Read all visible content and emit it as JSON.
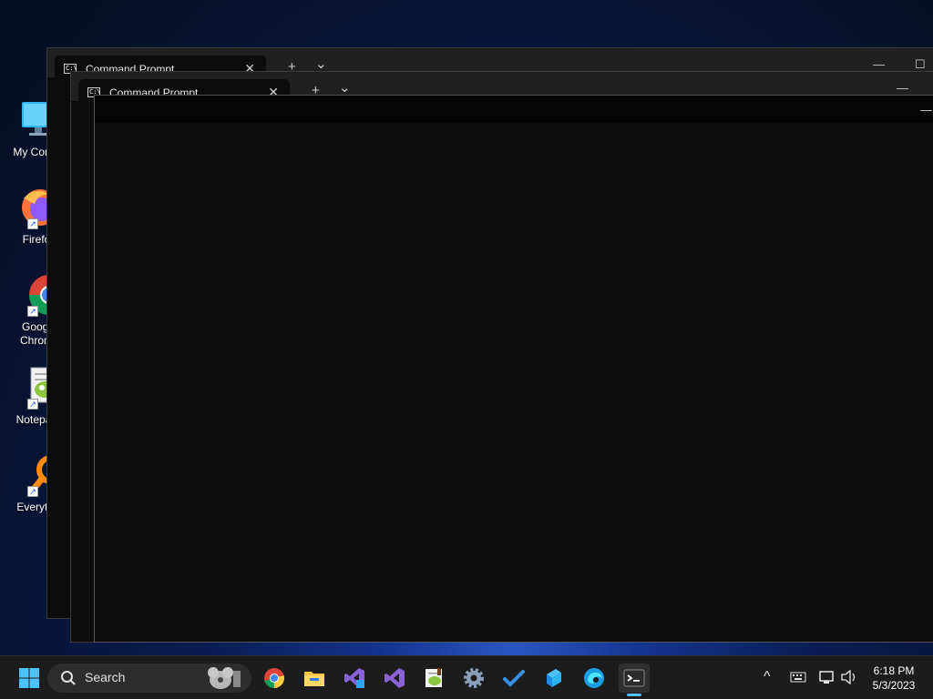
{
  "desktop": {
    "icons": [
      {
        "label": "My Comp",
        "icon": "computer-icon"
      },
      {
        "label": "Firefo",
        "icon": "firefox-icon"
      },
      {
        "label": "Googl",
        "label2": "Chrom",
        "icon": "chrome-icon"
      },
      {
        "label": "Notepac",
        "icon": "notepad-plus-plus-icon"
      },
      {
        "label": "Everythi",
        "icon": "everything-search-icon"
      }
    ]
  },
  "windows": [
    {
      "tab_title": "Command Prompt",
      "tab_icon_text": "C:\\",
      "new_tab": "+",
      "dropdown": "⌄",
      "close": "✕",
      "minimize": "—",
      "maximize": "☐"
    },
    {
      "tab_title": "Command Prompt",
      "tab_icon_text": "C:\\",
      "new_tab": "+",
      "dropdown": "⌄",
      "close": "✕",
      "minimize": "—"
    },
    {
      "minimize": "—"
    }
  ],
  "taskbar": {
    "search_placeholder": "Search",
    "apps": [
      "start-icon",
      "chrome-icon",
      "file-explorer-icon",
      "visual-studio-preview-icon",
      "visual-studio-icon",
      "notepad-plus-plus-icon",
      "settings-icon",
      "todo-icon",
      "azure-data-studio-icon",
      "edge-icon",
      "terminal-icon"
    ],
    "tray": {
      "chevron": "^",
      "keyboard": "keyboard-icon",
      "network": "network-icon",
      "volume": "volume-icon"
    },
    "time": "6:18 PM",
    "date": "5/3/2023"
  },
  "colors": {
    "taskbar_bg": "#1c1c1c",
    "terminal_bg": "#0c0c0c",
    "titlebar_bg": "#202020",
    "accent": "#4cc2ff"
  }
}
